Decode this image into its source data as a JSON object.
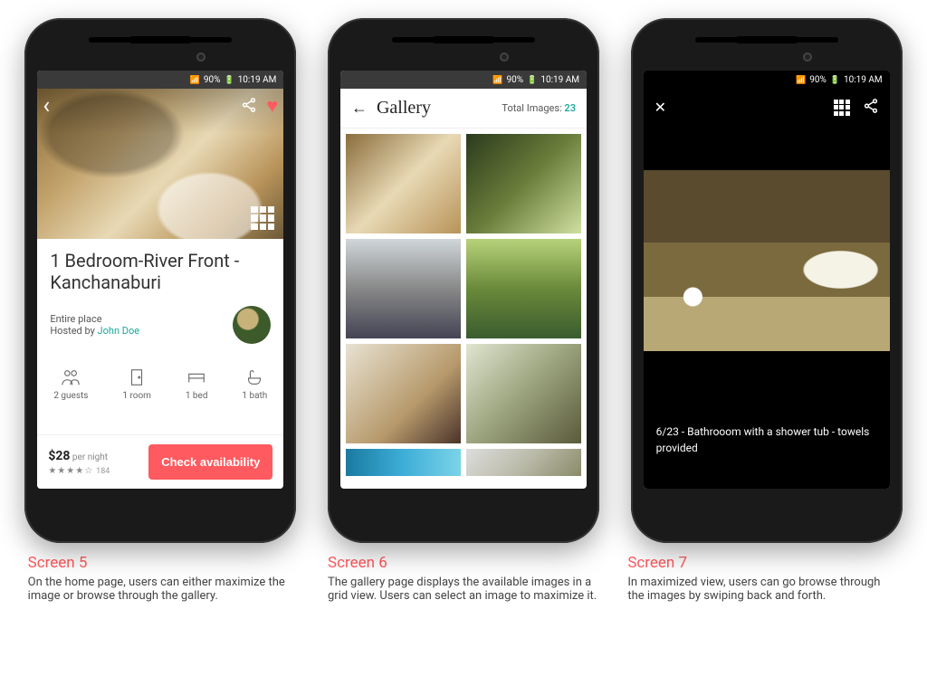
{
  "status": {
    "battery": "90%",
    "time": "10:19 AM"
  },
  "s5": {
    "title": "1 Bedroom-River Front -Kanchanaburi",
    "place_type": "Entire place",
    "hosted_by_prefix": "Hosted by ",
    "host_name": "John Doe",
    "amen": {
      "guests": "2 guests",
      "room": "1 room",
      "bed": "1 bed",
      "bath": "1 bath"
    },
    "price": "$28",
    "price_unit": " per night",
    "rating_stars": "★★★★☆",
    "rating_count": "184",
    "cta": "Check availability"
  },
  "s6": {
    "title": "Gallery",
    "total_label": "Total Images: ",
    "total_count": "23"
  },
  "s7": {
    "caption": "6/23 - Bathrooom with a shower tub - towels provided"
  },
  "legend": {
    "c5": {
      "h": "Screen 5",
      "p": "On the home page, users can either maximize the image or browse through the gallery."
    },
    "c6": {
      "h": "Screen 6",
      "p": "The gallery page displays the available images in a grid view. Users can select an image to maximize it."
    },
    "c7": {
      "h": "Screen 7",
      "p": "In maximized view, users can go browse through the images by swiping back and forth."
    }
  }
}
